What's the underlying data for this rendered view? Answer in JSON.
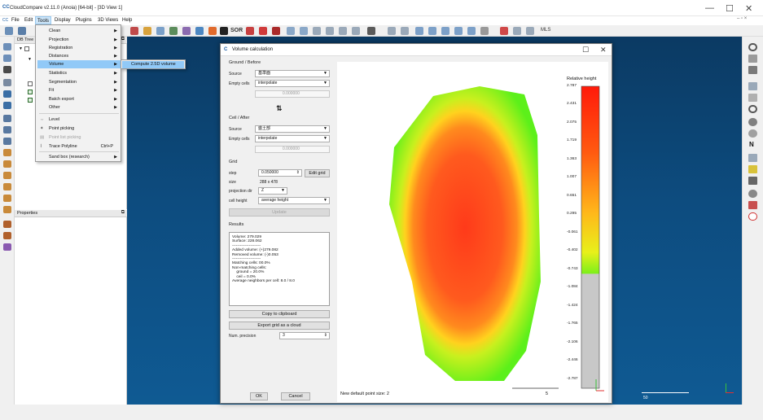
{
  "app": {
    "title": "CloudCompare v2.11.0 (Anoia) [64-bit] - [3D View 1]",
    "window_controls": [
      "—",
      "☐",
      "✕"
    ],
    "menu": [
      "File",
      "Edit",
      "Tools",
      "Display",
      "Plugins",
      "3D Views",
      "Help"
    ]
  },
  "toolbar": {
    "sor_label": "SOR",
    "mls_label": "MLS"
  },
  "panels": {
    "db_tree": "DB Tree",
    "properties": "Properties"
  },
  "tools_menu": {
    "items": [
      {
        "label": "Clean",
        "submenu": true
      },
      {
        "label": "Projection",
        "submenu": true
      },
      {
        "label": "Registration",
        "submenu": true
      },
      {
        "label": "Distances",
        "submenu": true
      },
      {
        "label": "Volume",
        "submenu": true,
        "highlighted": true
      },
      {
        "label": "Statistics",
        "submenu": true
      },
      {
        "label": "Segmentation",
        "submenu": true
      },
      {
        "label": "Fit",
        "submenu": true
      },
      {
        "label": "Batch export",
        "submenu": true
      },
      {
        "label": "Other",
        "submenu": true
      },
      {
        "label": "Level",
        "submenu": false
      },
      {
        "label": "Point picking",
        "submenu": false
      },
      {
        "label": "Point list picking",
        "submenu": false,
        "disabled": true
      },
      {
        "label": "Trace Polyline",
        "submenu": false,
        "shortcut": "Ctrl+P"
      },
      {
        "label": "Sand box (research)",
        "submenu": true
      }
    ],
    "volume_submenu": "Compute 2.5D volume"
  },
  "dialog": {
    "title": "Volume calculation",
    "ground": {
      "header": "Ground / Before",
      "source_label": "Source",
      "source_value": "基準面",
      "empty_label": "Empty cells",
      "empty_value": "interpolate",
      "height_value": "0.000000"
    },
    "swap_icon": "swap-icon",
    "ceil": {
      "header": "Ceil / After",
      "source_label": "Source",
      "source_value": "盛土部",
      "empty_label": "Empty cells",
      "empty_value": "interpolate",
      "height_value": "0.000000"
    },
    "grid": {
      "header": "Grid",
      "step_label": "step",
      "step_value": "0.050000",
      "edit_grid": "Edit grid",
      "size_label": "size",
      "size_value": "288 x 478",
      "projdir_label": "projection dir",
      "projdir_value": "Z",
      "cellheight_label": "cell height",
      "cellheight_value": "average height",
      "update_button": "Update"
    },
    "results": {
      "header": "Results",
      "text": "Volume: 279.029\nSurface: 228.062\n----------------------\nAdded volume: (+)279.082\nRemoved volume: (-)0.053\n----------------------\nMatching cells: 00.0%\nNon-matching cells:\n    ground = 20.0%\n    ceil = 0.0%\nAverage neighbors per cell: 8.0 / 8.0"
    },
    "copy_button": "Copy to clipboard",
    "export_button": "Export grid as a cloud",
    "precision_label": "Num. precision",
    "precision_value": "3",
    "ok": "OK",
    "cancel": "Cancel",
    "status": "New default point size: 2",
    "scale_label": "5",
    "colorbar": {
      "title": "Relative height",
      "ticks": [
        "2.787",
        "2.431",
        "2.075",
        "1.719",
        "1.363",
        "1.007",
        "0.651",
        "0.295",
        "-0.061",
        "-0.402",
        "-0.743",
        "-1.084",
        "-1.424",
        "-1.765",
        "-2.106",
        "-2.446",
        "-2.787"
      ]
    }
  },
  "view3d": {
    "scale_label": "50"
  }
}
